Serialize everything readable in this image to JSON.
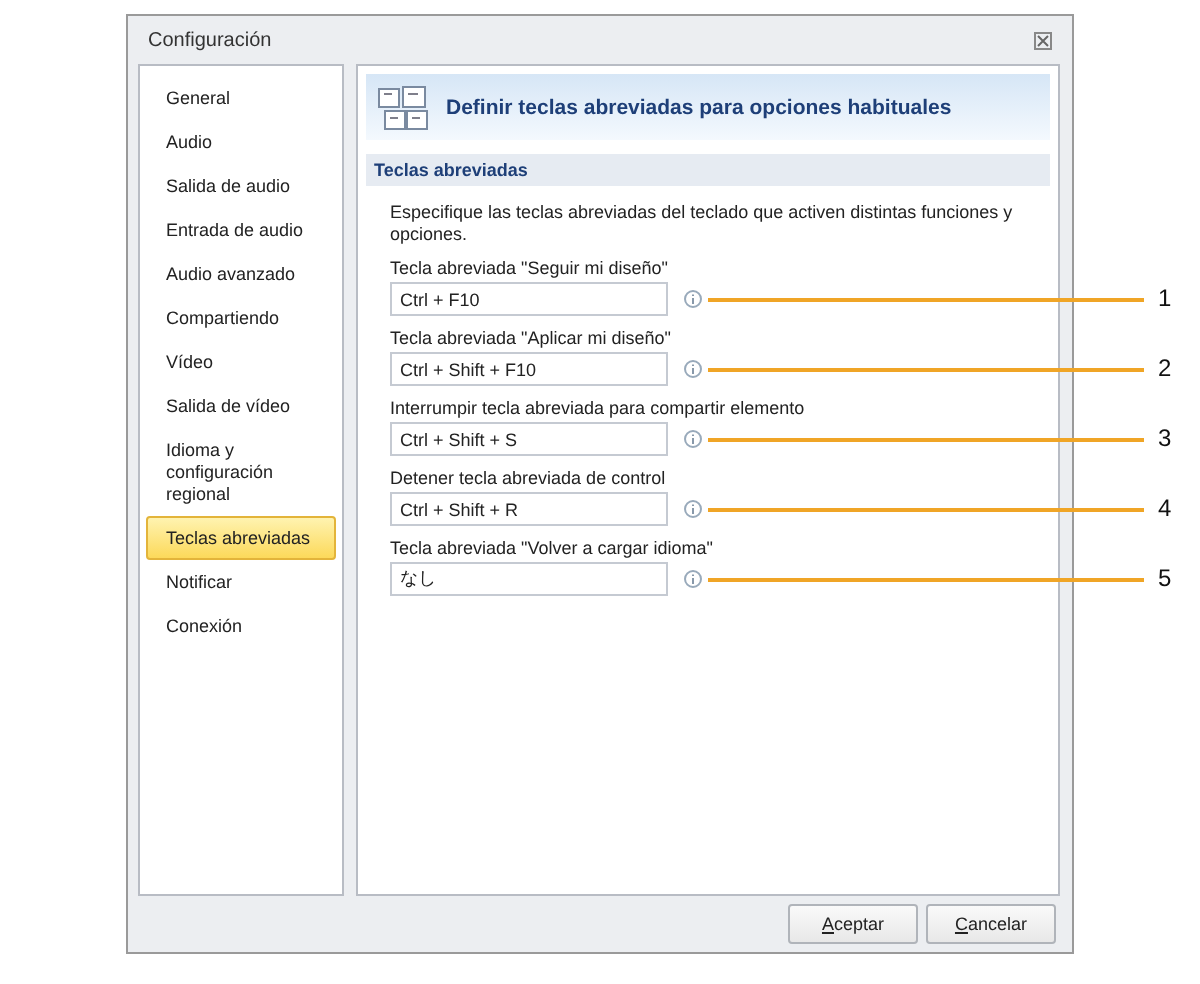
{
  "window": {
    "title": "Configuración"
  },
  "sidebar": {
    "items": [
      {
        "label": "General",
        "selected": false
      },
      {
        "label": "Audio",
        "selected": false
      },
      {
        "label": "Salida de audio",
        "selected": false
      },
      {
        "label": "Entrada de audio",
        "selected": false
      },
      {
        "label": "Audio avanzado",
        "selected": false
      },
      {
        "label": "Compartiendo",
        "selected": false
      },
      {
        "label": "Vídeo",
        "selected": false
      },
      {
        "label": "Salida de vídeo",
        "selected": false
      },
      {
        "label": "Idioma y configuración regional",
        "selected": false
      },
      {
        "label": "Teclas abreviadas",
        "selected": true
      },
      {
        "label": "Notificar",
        "selected": false
      },
      {
        "label": "Conexión",
        "selected": false
      }
    ]
  },
  "header": {
    "title": "Definir teclas abreviadas para opciones habituales"
  },
  "section": {
    "title": "Teclas abreviadas",
    "description": "Especifique las teclas abreviadas del teclado que activen distintas funciones y opciones."
  },
  "shortcuts": [
    {
      "label": "Tecla abreviada \"Seguir mi diseño\"",
      "value": "Ctrl + F10",
      "callout": "1"
    },
    {
      "label": "Tecla abreviada \"Aplicar mi diseño\"",
      "value": "Ctrl + Shift + F10",
      "callout": "2"
    },
    {
      "label": "Interrumpir tecla abreviada para compartir elemento",
      "value": "Ctrl + Shift + S",
      "callout": "3"
    },
    {
      "label": "Detener tecla abreviada de control",
      "value": "Ctrl + Shift + R",
      "callout": "4"
    },
    {
      "label": "Tecla abreviada \"Volver a cargar idioma\"",
      "value": "なし",
      "callout": "5"
    }
  ],
  "buttons": [
    "Aceptar",
    "Cancelar"
  ]
}
